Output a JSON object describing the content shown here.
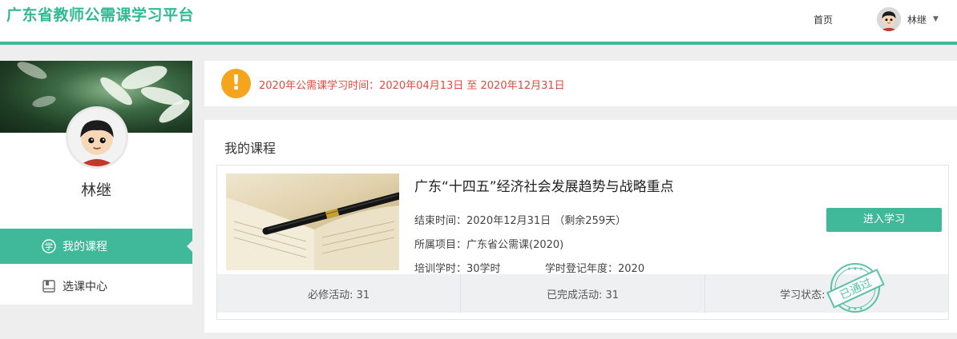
{
  "header": {
    "brand": "广东省教师公需课学习平台",
    "nav_home": "首页",
    "user_name": "林继"
  },
  "sidebar": {
    "user_name": "林继",
    "items": [
      {
        "label": "我的课程",
        "icon": "study-icon",
        "active": true
      },
      {
        "label": "选课中心",
        "icon": "book-icon",
        "active": false
      }
    ]
  },
  "notice": {
    "text": "2020年公需课学习时间：2020年04月13日 至 2020年12月31日"
  },
  "courses": {
    "section_title": "我的课程",
    "items": [
      {
        "title": "广东“十四五”经济社会发展趋势与战略重点",
        "end_time": "结束时间：2020年12月31日 （剩余259天）",
        "project": "所属项目：广东省公需课(2020)",
        "hours": "培训学时：30学时",
        "year": "学时登记年度：2020",
        "enter_label": "进入学习",
        "required_activities": "必修活动: 31",
        "completed_activities": "已完成活动: 31",
        "status_label": "学习状态:",
        "stamp_text": "已通过"
      }
    ]
  },
  "colors": {
    "accent": "#3fb99a",
    "brand": "#33b894",
    "notice_text": "#e24a3f",
    "warning": "#f5a41d"
  }
}
